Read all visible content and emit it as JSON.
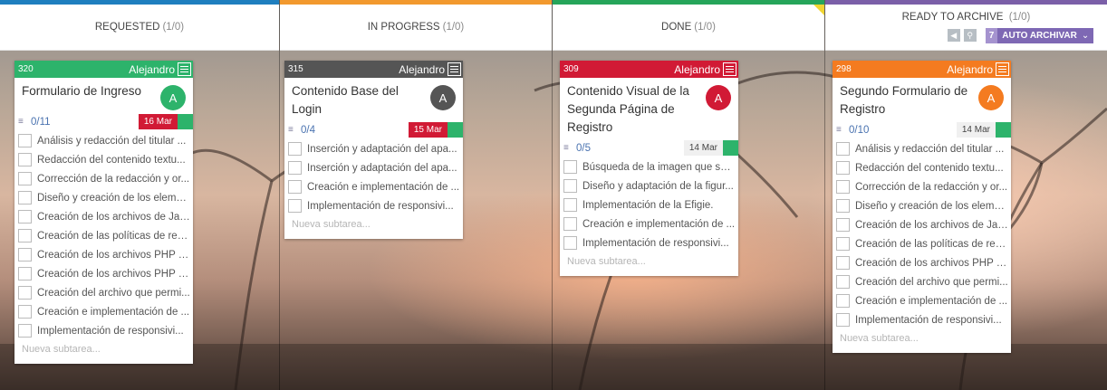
{
  "colors": {
    "requested": "#1f7fbf",
    "in_progress": "#f2992e",
    "done": "#26a55a",
    "ready": "#7b5fa8"
  },
  "columns": [
    {
      "title": "REQUESTED",
      "count": "(1/0)"
    },
    {
      "title": "IN PROGRESS",
      "count": "(1/0)"
    },
    {
      "title": "DONE",
      "count": "(1/0)"
    },
    {
      "title": "READY TO ARCHIVE",
      "count": "(1/0)"
    }
  ],
  "archive": {
    "icon1": "arrow-icon",
    "icon2": "search-icon",
    "count": "7",
    "label": "AUTO ARCHIVAR",
    "chevron": "chevron-down-icon"
  },
  "cards": [
    {
      "id": "320",
      "owner": "Alejandro",
      "title": "Formulario de Ingreso",
      "avatar": "A",
      "avatar_color": "#2db36b",
      "header_color": "#2db36b",
      "progress": "0/11",
      "date": "16 Mar",
      "date_style": "red",
      "subtasks": [
        "Análisis y redacción del titular ...",
        "Redacción del contenido textu...",
        "Corrección de la redacción y or...",
        "Diseño y creación de los eleme...",
        "Creación de los archivos de Jav...",
        "Creación de las políticas de res...",
        "Creación de los archivos PHP q...",
        "Creación de los archivos PHP q...",
        "Creación del archivo que permi...",
        "Creación e implementación de ...",
        "Implementación de responsivi..."
      ],
      "new_subtask": "Nueva subtarea..."
    },
    {
      "id": "315",
      "owner": "Alejandro",
      "title": "Contenido Base del Login",
      "avatar": "A",
      "avatar_color": "#555555",
      "header_color": "#555555",
      "progress": "0/4",
      "date": "15 Mar",
      "date_style": "red",
      "subtasks": [
        "Inserción y adaptación del apa...",
        "Inserción y adaptación del apa...",
        "Creación e implementación de ...",
        "Implementación de responsivi..."
      ],
      "new_subtask": "Nueva subtarea..."
    },
    {
      "id": "309",
      "owner": "Alejandro",
      "title": "Contenido Visual de la Segunda Página de Registro",
      "avatar": "A",
      "avatar_color": "#d11a35",
      "header_color": "#d11a35",
      "progress": "0/5",
      "date": "14 Mar",
      "date_style": "grey",
      "subtasks": [
        "Búsqueda de la imagen que se ...",
        "Diseño y adaptación de la figur...",
        "Implementación de la Efigie.",
        "Creación e implementación de ...",
        "Implementación de responsivi..."
      ],
      "new_subtask": "Nueva subtarea..."
    },
    {
      "id": "298",
      "owner": "Alejandro",
      "title": "Segundo Formulario de Registro",
      "avatar": "A",
      "avatar_color": "#f47b20",
      "header_color": "#f47b20",
      "progress": "0/10",
      "date": "14 Mar",
      "date_style": "grey",
      "subtasks": [
        "Análisis y redacción del titular ...",
        "Redacción del contenido textu...",
        "Corrección de la redacción y or...",
        "Diseño y creación de los eleme...",
        "Creación de los archivos de Jav...",
        "Creación de las políticas de res...",
        "Creación de los archivos PHP q...",
        "Creación del archivo que permi...",
        "Creación e implementación de ...",
        "Implementación de responsivi..."
      ],
      "new_subtask": "Nueva subtarea..."
    }
  ]
}
